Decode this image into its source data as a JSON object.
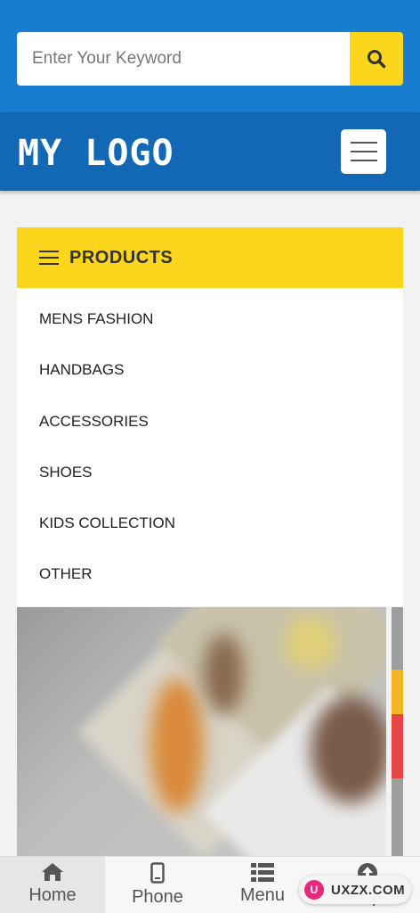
{
  "search": {
    "placeholder": "Enter Your Keyword",
    "button_icon": "search-icon"
  },
  "header": {
    "logo": "MY LOGO",
    "menu_icon": "hamburger-icon"
  },
  "products": {
    "title": "PRODUCTS",
    "items": [
      {
        "label": "MENS FASHION"
      },
      {
        "label": "HANDBAGS"
      },
      {
        "label": "ACCESSORIES"
      },
      {
        "label": "SHOES"
      },
      {
        "label": "KIDS COLLECTION"
      },
      {
        "label": "OTHER"
      }
    ]
  },
  "bottom_nav": [
    {
      "label": "Home",
      "icon": "home-icon",
      "active": true
    },
    {
      "label": "Phone",
      "icon": "phone-icon"
    },
    {
      "label": "Menu",
      "icon": "list-icon"
    },
    {
      "label": "Top",
      "icon": "arrow-up-icon"
    }
  ],
  "watermark": {
    "text": "UXZX.COM"
  },
  "colors": {
    "search_bg": "#187dd1",
    "header_bg": "#1368b5",
    "accent_yellow": "#fcd61c",
    "accent_red": "#e44645"
  }
}
